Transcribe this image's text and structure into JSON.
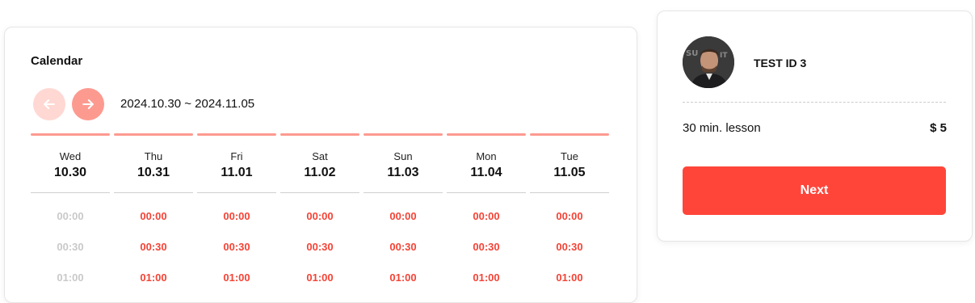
{
  "calendar": {
    "title": "Calendar",
    "range": "2024.10.30 ~ 2024.11.05",
    "prev_icon": "arrow-left-icon",
    "next_icon": "arrow-right-icon",
    "days": [
      {
        "name": "Wed",
        "date": "10.30",
        "slots": [
          {
            "time": "00:00",
            "available": false
          },
          {
            "time": "00:30",
            "available": false
          },
          {
            "time": "01:00",
            "available": false
          }
        ]
      },
      {
        "name": "Thu",
        "date": "10.31",
        "slots": [
          {
            "time": "00:00",
            "available": true
          },
          {
            "time": "00:30",
            "available": true
          },
          {
            "time": "01:00",
            "available": true
          }
        ]
      },
      {
        "name": "Fri",
        "date": "11.01",
        "slots": [
          {
            "time": "00:00",
            "available": true
          },
          {
            "time": "00:30",
            "available": true
          },
          {
            "time": "01:00",
            "available": true
          }
        ]
      },
      {
        "name": "Sat",
        "date": "11.02",
        "slots": [
          {
            "time": "00:00",
            "available": true
          },
          {
            "time": "00:30",
            "available": true
          },
          {
            "time": "01:00",
            "available": true
          }
        ]
      },
      {
        "name": "Sun",
        "date": "11.03",
        "slots": [
          {
            "time": "00:00",
            "available": true
          },
          {
            "time": "00:30",
            "available": true
          },
          {
            "time": "01:00",
            "available": true
          }
        ]
      },
      {
        "name": "Mon",
        "date": "11.04",
        "slots": [
          {
            "time": "00:00",
            "available": true
          },
          {
            "time": "00:30",
            "available": true
          },
          {
            "time": "01:00",
            "available": true
          }
        ]
      },
      {
        "name": "Tue",
        "date": "11.05",
        "slots": [
          {
            "time": "00:00",
            "available": true
          },
          {
            "time": "00:30",
            "available": true
          },
          {
            "time": "01:00",
            "available": true
          }
        ]
      }
    ]
  },
  "summary": {
    "tutor_name": "TEST ID 3",
    "lesson": "30 min. lesson",
    "price": "$ 5",
    "next_label": "Next"
  },
  "colors": {
    "accent": "#ff453a",
    "available": "#f44336",
    "unavailable": "#c9c9c9",
    "day_bar": "#fd9a90"
  }
}
